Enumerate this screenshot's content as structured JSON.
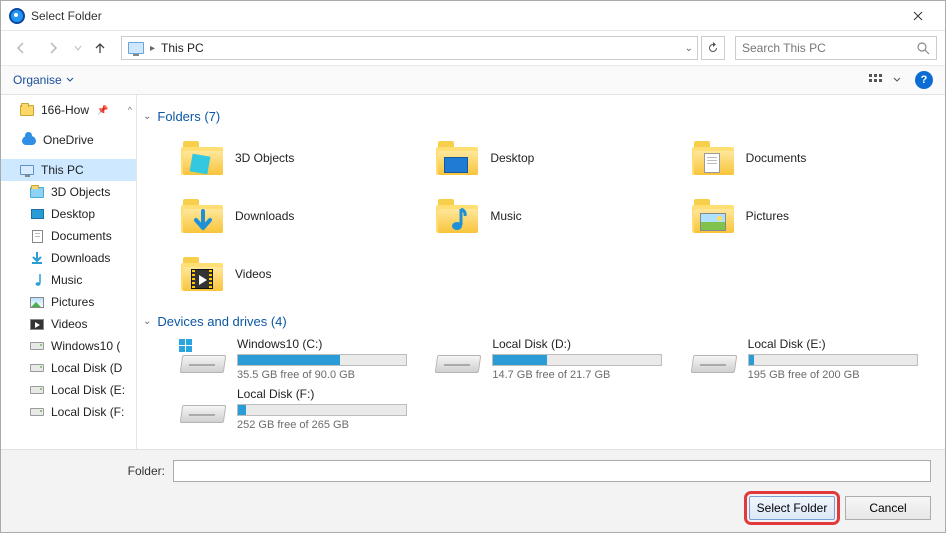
{
  "window": {
    "title": "Select Folder"
  },
  "nav": {
    "location": "This PC",
    "search_placeholder": "Search This PC"
  },
  "toolbar": {
    "organise": "Organise"
  },
  "tree": {
    "quick_166": "166-How",
    "onedrive": "OneDrive",
    "thispc": "This PC",
    "objects3d": "3D Objects",
    "desktop": "Desktop",
    "documents": "Documents",
    "downloads": "Downloads",
    "music": "Music",
    "pictures": "Pictures",
    "videos": "Videos",
    "win10c": "Windows10 (",
    "ldd": "Local Disk (D",
    "lde": "Local Disk (E:",
    "ldf": "Local Disk (F:"
  },
  "sections": {
    "folders_label": "Folders (7)",
    "drives_label": "Devices and drives (4)"
  },
  "folders": {
    "objects3d": "3D Objects",
    "desktop": "Desktop",
    "documents": "Documents",
    "downloads": "Downloads",
    "music": "Music",
    "pictures": "Pictures",
    "videos": "Videos"
  },
  "drives": [
    {
      "name": "Windows10 (C:)",
      "free_text": "35.5 GB free of 90.0 GB",
      "used_pct": 61
    },
    {
      "name": "Local Disk (D:)",
      "free_text": "14.7 GB free of 21.7 GB",
      "used_pct": 32
    },
    {
      "name": "Local Disk (E:)",
      "free_text": "195 GB free of 200 GB",
      "used_pct": 3
    },
    {
      "name": "Local Disk (F:)",
      "free_text": "252 GB free of 265 GB",
      "used_pct": 5
    }
  ],
  "footer": {
    "folder_label": "Folder:",
    "folder_value": "",
    "select_btn": "Select Folder",
    "cancel_btn": "Cancel"
  }
}
